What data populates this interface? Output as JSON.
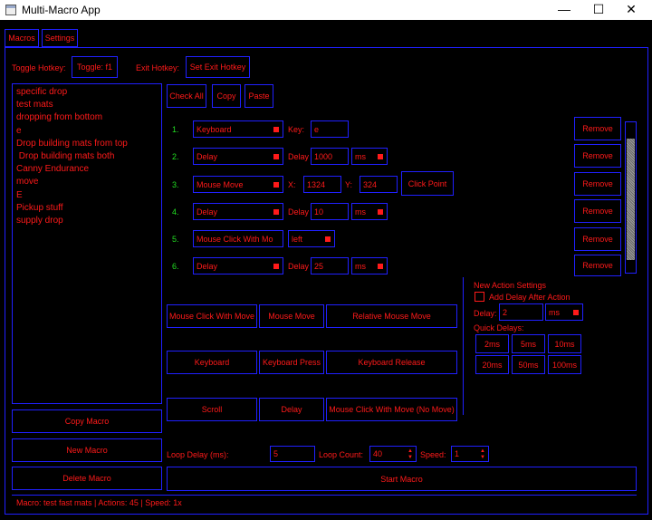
{
  "window": {
    "title": "Multi-Macro App",
    "minimize": "—",
    "maximize": "☐",
    "close": "✕"
  },
  "tabs": [
    {
      "label": "Macros"
    },
    {
      "label": "Settings"
    }
  ],
  "hotkeys": {
    "toggle_label": "Toggle Hotkey:",
    "toggle_button": "Toggle: f1",
    "exit_label": "Exit Hotkey:",
    "exit_button": "Set Exit Hotkey"
  },
  "macro_list": [
    "specific drop",
    "test mats",
    "dropping from bottom",
    "e",
    "Drop building mats from top",
    " Drop building mats both",
    "Canny Endurance",
    "move",
    "E",
    "Pickup stuff",
    "supply drop"
  ],
  "toolbar": {
    "check_all": "Check All",
    "copy": "Copy",
    "paste": "Paste"
  },
  "actions": [
    {
      "num": "1.",
      "type": "Keyboard",
      "param_label": "Key:",
      "value": "e"
    },
    {
      "num": "2.",
      "type": "Delay",
      "param_label": "Delay",
      "value": "1000",
      "unit": "ms"
    },
    {
      "num": "3.",
      "type": "Mouse Move",
      "x_label": "X:",
      "x": "1324",
      "y_label": "Y:",
      "y": "324",
      "click_point": "Click Point"
    },
    {
      "num": "4.",
      "type": "Delay",
      "param_label": "Delay",
      "value": "10",
      "unit": "ms"
    },
    {
      "num": "5.",
      "type": "Mouse Click With Mo",
      "button": "left"
    },
    {
      "num": "6.",
      "type": "Delay",
      "param_label": "Delay",
      "value": "25",
      "unit": "ms"
    }
  ],
  "remove_label": "Remove",
  "add_buttons": {
    "mouse_click_with_move": "Mouse Click With Move",
    "mouse_move": "Mouse Move",
    "relative_mouse_move": "Relative Mouse Move",
    "keyboard": "Keyboard",
    "keyboard_press": "Keyboard Press",
    "keyboard_release": "Keyboard Release",
    "scroll": "Scroll",
    "delay": "Delay",
    "mouse_click_no_move": "Mouse Click With Move (No Move)"
  },
  "new_action_settings": {
    "title": "New Action Settings",
    "add_delay_label": "Add Delay After Action",
    "add_delay_checked": false,
    "delay_label": "Delay:",
    "delay_value": "2",
    "delay_unit": "ms",
    "quick_delays_label": "Quick Delays:",
    "quick_delays": [
      "2ms",
      "5ms",
      "10ms",
      "20ms",
      "50ms",
      "100ms"
    ]
  },
  "left_buttons": {
    "copy_macro": "Copy Macro",
    "new_macro": "New Macro",
    "delete_macro": "Delete Macro"
  },
  "loop": {
    "loop_delay_label": "Loop Delay (ms):",
    "loop_delay_value": "5",
    "loop_count_label": "Loop Count:",
    "loop_count_value": "40",
    "speed_label": "Speed:",
    "speed_value": "1"
  },
  "start_macro": "Start Macro",
  "status": "Macro: test fast mats | Actions: 45 | Speed: 1x",
  "colors": {
    "accent": "#ff1a1a",
    "border": "#2020ff",
    "number": "#22dd22",
    "background": "#000000"
  }
}
